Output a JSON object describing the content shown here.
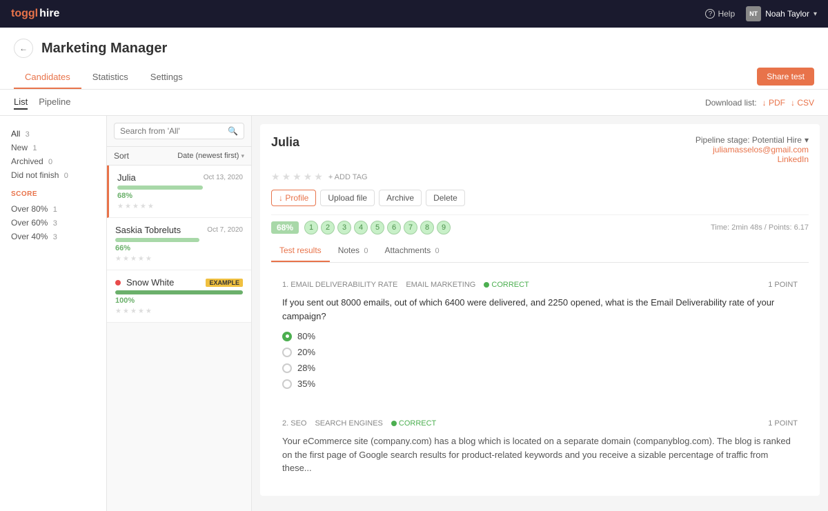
{
  "topnav": {
    "brand_toggl": "toggl",
    "brand_hire": "hire",
    "help_label": "Help",
    "user_initials": "NT",
    "user_name": "Noah Taylor"
  },
  "page": {
    "back_label": "←",
    "title": "Marketing Manager",
    "tabs": [
      "Candidates",
      "Statistics",
      "Settings"
    ],
    "active_tab": "Candidates",
    "share_test_label": "Share test"
  },
  "view": {
    "tabs": [
      "List",
      "Pipeline"
    ],
    "active_tab": "List",
    "download_label": "Download list:",
    "pdf_label": "↓ PDF",
    "csv_label": "↓ CSV"
  },
  "filters": {
    "status_items": [
      {
        "label": "All",
        "count": "3",
        "active": true
      },
      {
        "label": "New",
        "count": "1"
      },
      {
        "label": "Archived",
        "count": "0"
      },
      {
        "label": "Did not finish",
        "count": "0"
      }
    ],
    "score_header": "SCORE",
    "score_items": [
      {
        "label": "Over 80%",
        "count": "1"
      },
      {
        "label": "Over 60%",
        "count": "3"
      },
      {
        "label": "Over 40%",
        "count": "3"
      }
    ]
  },
  "candidate_list": {
    "search_placeholder": "Search from 'All'",
    "sort_label": "Sort",
    "sort_value": "Date (newest first)",
    "candidates": [
      {
        "name": "Julia",
        "date": "Oct 13, 2020",
        "score": "68%",
        "score_width": 68,
        "active": true
      },
      {
        "name": "Saskia Tobreluts",
        "date": "Oct 7, 2020",
        "score": "66%",
        "score_width": 66,
        "active": false
      },
      {
        "name": "Snow White",
        "date": "",
        "score": "100%",
        "score_width": 100,
        "active": false,
        "is_example": true,
        "has_red_dot": true
      }
    ]
  },
  "candidate_detail": {
    "name": "Julia",
    "pipeline_label": "Pipeline stage: Potential Hire",
    "email": "juliamasselos@gmail.com",
    "linkedin": "LinkedIn",
    "add_tag_label": "+ ADD TAG",
    "actions": [
      {
        "label": "↓ Profile",
        "download": true
      },
      {
        "label": "Upload file"
      },
      {
        "label": "Archive"
      },
      {
        "label": "Delete"
      }
    ],
    "score_pct": "68%",
    "question_nums": [
      "1",
      "2",
      "3",
      "4",
      "5",
      "6",
      "7",
      "8",
      "9"
    ],
    "score_time": "Time: 2min 48s / Points: 6.17",
    "result_tabs": [
      {
        "label": "Test results",
        "count": ""
      },
      {
        "label": "Notes",
        "count": "0"
      },
      {
        "label": "Attachments",
        "count": "0"
      }
    ]
  },
  "questions": [
    {
      "num": "1. EMAIL DELIVERABILITY RATE",
      "topic": "EMAIL MARKETING",
      "correct": true,
      "correct_label": "CORRECT",
      "points": "1 POINT",
      "text": "If you sent out 8000 emails, out of which 6400 were delivered, and 2250 opened, what is the Email Deliverability rate of your campaign?",
      "options": [
        {
          "label": "80%",
          "correct": true
        },
        {
          "label": "20%",
          "correct": false
        },
        {
          "label": "28%",
          "correct": false
        },
        {
          "label": "35%",
          "correct": false
        }
      ]
    },
    {
      "num": "2. SEO",
      "topic": "SEARCH ENGINES",
      "correct": true,
      "correct_label": "CORRECT",
      "points": "1 POINT",
      "text": "Your eCommerce site (company.com) has a blog which is located on a separate domain (companyblog.com). The blog is ranked on the first page of Google search results for product-related keywords and you receive a sizable percentage of traffic from these...",
      "options": []
    }
  ]
}
